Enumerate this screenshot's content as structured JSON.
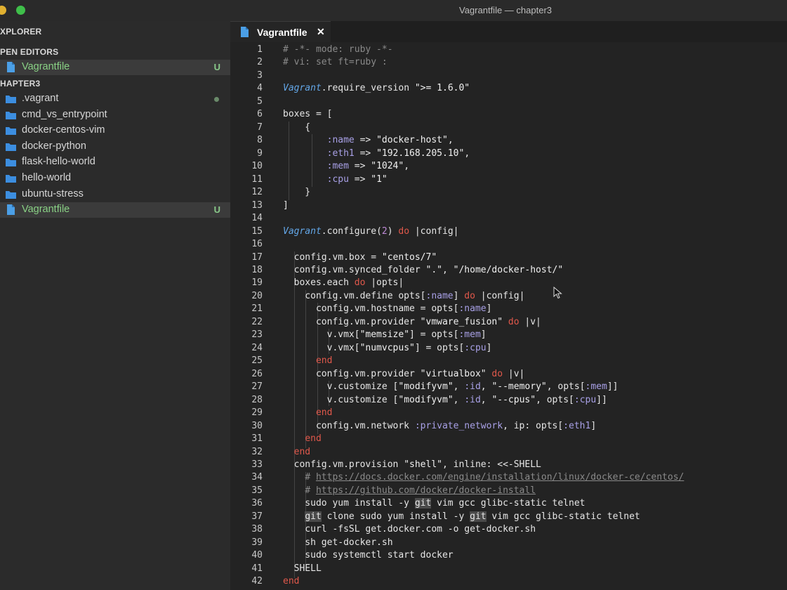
{
  "window": {
    "title": "Vagrantfile — chapter3"
  },
  "sidebar": {
    "explorer_title": "XPLORER",
    "open_editors_title": "PEN EDITORS",
    "open_editors": [
      {
        "label": "Vagrantfile",
        "badge": "U"
      }
    ],
    "folder_title": "HAPTER3",
    "items": [
      {
        "label": ".vagrant",
        "type": "folder"
      },
      {
        "label": "cmd_vs_entrypoint",
        "type": "folder"
      },
      {
        "label": "docker-centos-vim",
        "type": "folder"
      },
      {
        "label": "docker-python",
        "type": "folder"
      },
      {
        "label": "flask-hello-world",
        "type": "folder"
      },
      {
        "label": "hello-world",
        "type": "folder"
      },
      {
        "label": "ubuntu-stress",
        "type": "folder"
      },
      {
        "label": "Vagrantfile",
        "type": "file",
        "badge": "U"
      }
    ]
  },
  "tab": {
    "label": "Vagrantfile",
    "close": "✕"
  },
  "editor": {
    "line_numbers": [
      "1",
      "2",
      "3",
      "4",
      "5",
      "6",
      "7",
      "8",
      "9",
      "10",
      "11",
      "12",
      "13",
      "14",
      "15",
      "16",
      "17",
      "18",
      "19",
      "20",
      "21",
      "22",
      "23",
      "24",
      "25",
      "26",
      "27",
      "28",
      "29",
      "30",
      "31",
      "32",
      "33",
      "34",
      "35",
      "36",
      "37",
      "38",
      "39",
      "40",
      "41",
      "42"
    ],
    "lines": [
      "# -*- mode: ruby -*-",
      "# vi: set ft=ruby :",
      "",
      "Vagrant.require_version \">= 1.6.0\"",
      "",
      "boxes = [",
      "    {",
      "        :name => \"docker-host\",",
      "        :eth1 => \"192.168.205.10\",",
      "        :mem => \"1024\",",
      "        :cpu => \"1\"",
      "    }",
      "]",
      "",
      "Vagrant.configure(2) do |config|",
      "",
      "  config.vm.box = \"centos/7\"",
      "  config.vm.synced_folder \".\", \"/home/docker-host/\"",
      "  boxes.each do |opts|",
      "    config.vm.define opts[:name] do |config|",
      "      config.vm.hostname = opts[:name]",
      "      config.vm.provider \"vmware_fusion\" do |v|",
      "        v.vmx[\"memsize\"] = opts[:mem]",
      "        v.vmx[\"numvcpus\"] = opts[:cpu]",
      "      end",
      "      config.vm.provider \"virtualbox\" do |v|",
      "        v.customize [\"modifyvm\", :id, \"--memory\", opts[:mem]]",
      "        v.customize [\"modifyvm\", :id, \"--cpus\", opts[:cpu]]",
      "      end",
      "      config.vm.network :private_network, ip: opts[:eth1]",
      "    end",
      "  end",
      "  config.vm.provision \"shell\", inline: <<-SHELL",
      "    # https://docs.docker.com/engine/installation/linux/docker-ce/centos/",
      "    # https://github.com/docker/docker-install",
      "    sudo yum install -y git vim gcc glibc-static telnet",
      "    git clone sudo yum install -y git vim gcc glibc-static telnet",
      "    curl -fsSL get.docker.com -o get-docker.sh",
      "    sh get-docker.sh",
      "    sudo systemctl start docker",
      "  SHELL",
      "end"
    ]
  },
  "icons": {
    "folder": "folder-icon",
    "file": "file-icon",
    "close": "close-icon",
    "pointer": "mouse-pointer-icon"
  },
  "colors": {
    "keyword": "#e0584b",
    "symbol": "#a8a0e6",
    "class": "#63a7e8",
    "comment": "#8a8a8a",
    "untracked": "#89d185"
  }
}
